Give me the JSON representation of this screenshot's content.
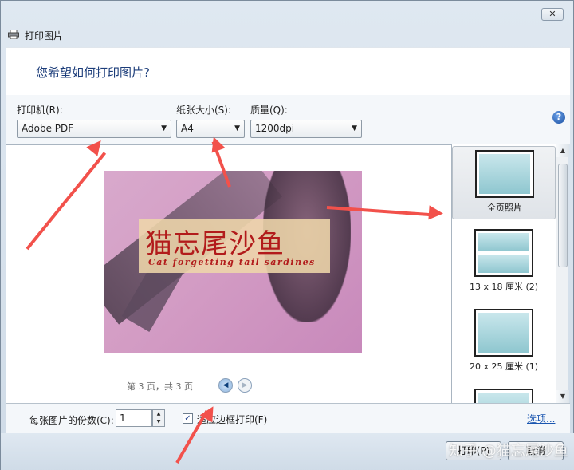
{
  "window": {
    "title": "打印图片",
    "close_label": "✕"
  },
  "header": {
    "question": "您希望如何打印图片?"
  },
  "controls": {
    "printer_label": "打印机(R):",
    "printer_value": "Adobe PDF",
    "paper_label": "纸张大小(S):",
    "paper_value": "A4",
    "quality_label": "质量(Q):",
    "quality_value": "1200dpi",
    "help_label": "?"
  },
  "preview": {
    "banner_cn": "猫忘尾沙鱼",
    "banner_en": "Cat forgetting tail sardines",
    "page_info": "第 3 页，共 3 页",
    "prev_glyph": "◀",
    "next_glyph": "▶"
  },
  "layouts": [
    {
      "label": "全页照片",
      "selected": true
    },
    {
      "label": "13 x 18 厘米 (2)",
      "selected": false
    },
    {
      "label": "20 x 25 厘米 (1)",
      "selected": false
    }
  ],
  "bottom": {
    "copies_label": "每张图片的份数(C):",
    "copies_value": "1",
    "fit_label": "适应边框打印(F)",
    "fit_checked": true,
    "options_link": "选项..."
  },
  "footer": {
    "print_button": "打印(P)",
    "cancel_button": "取消",
    "watermark": "知乎 @猫忘尾沙鱼"
  },
  "colors": {
    "annotation_arrow": "#f2514b",
    "link": "#1a56b0",
    "banner_text": "#b21b1b"
  }
}
